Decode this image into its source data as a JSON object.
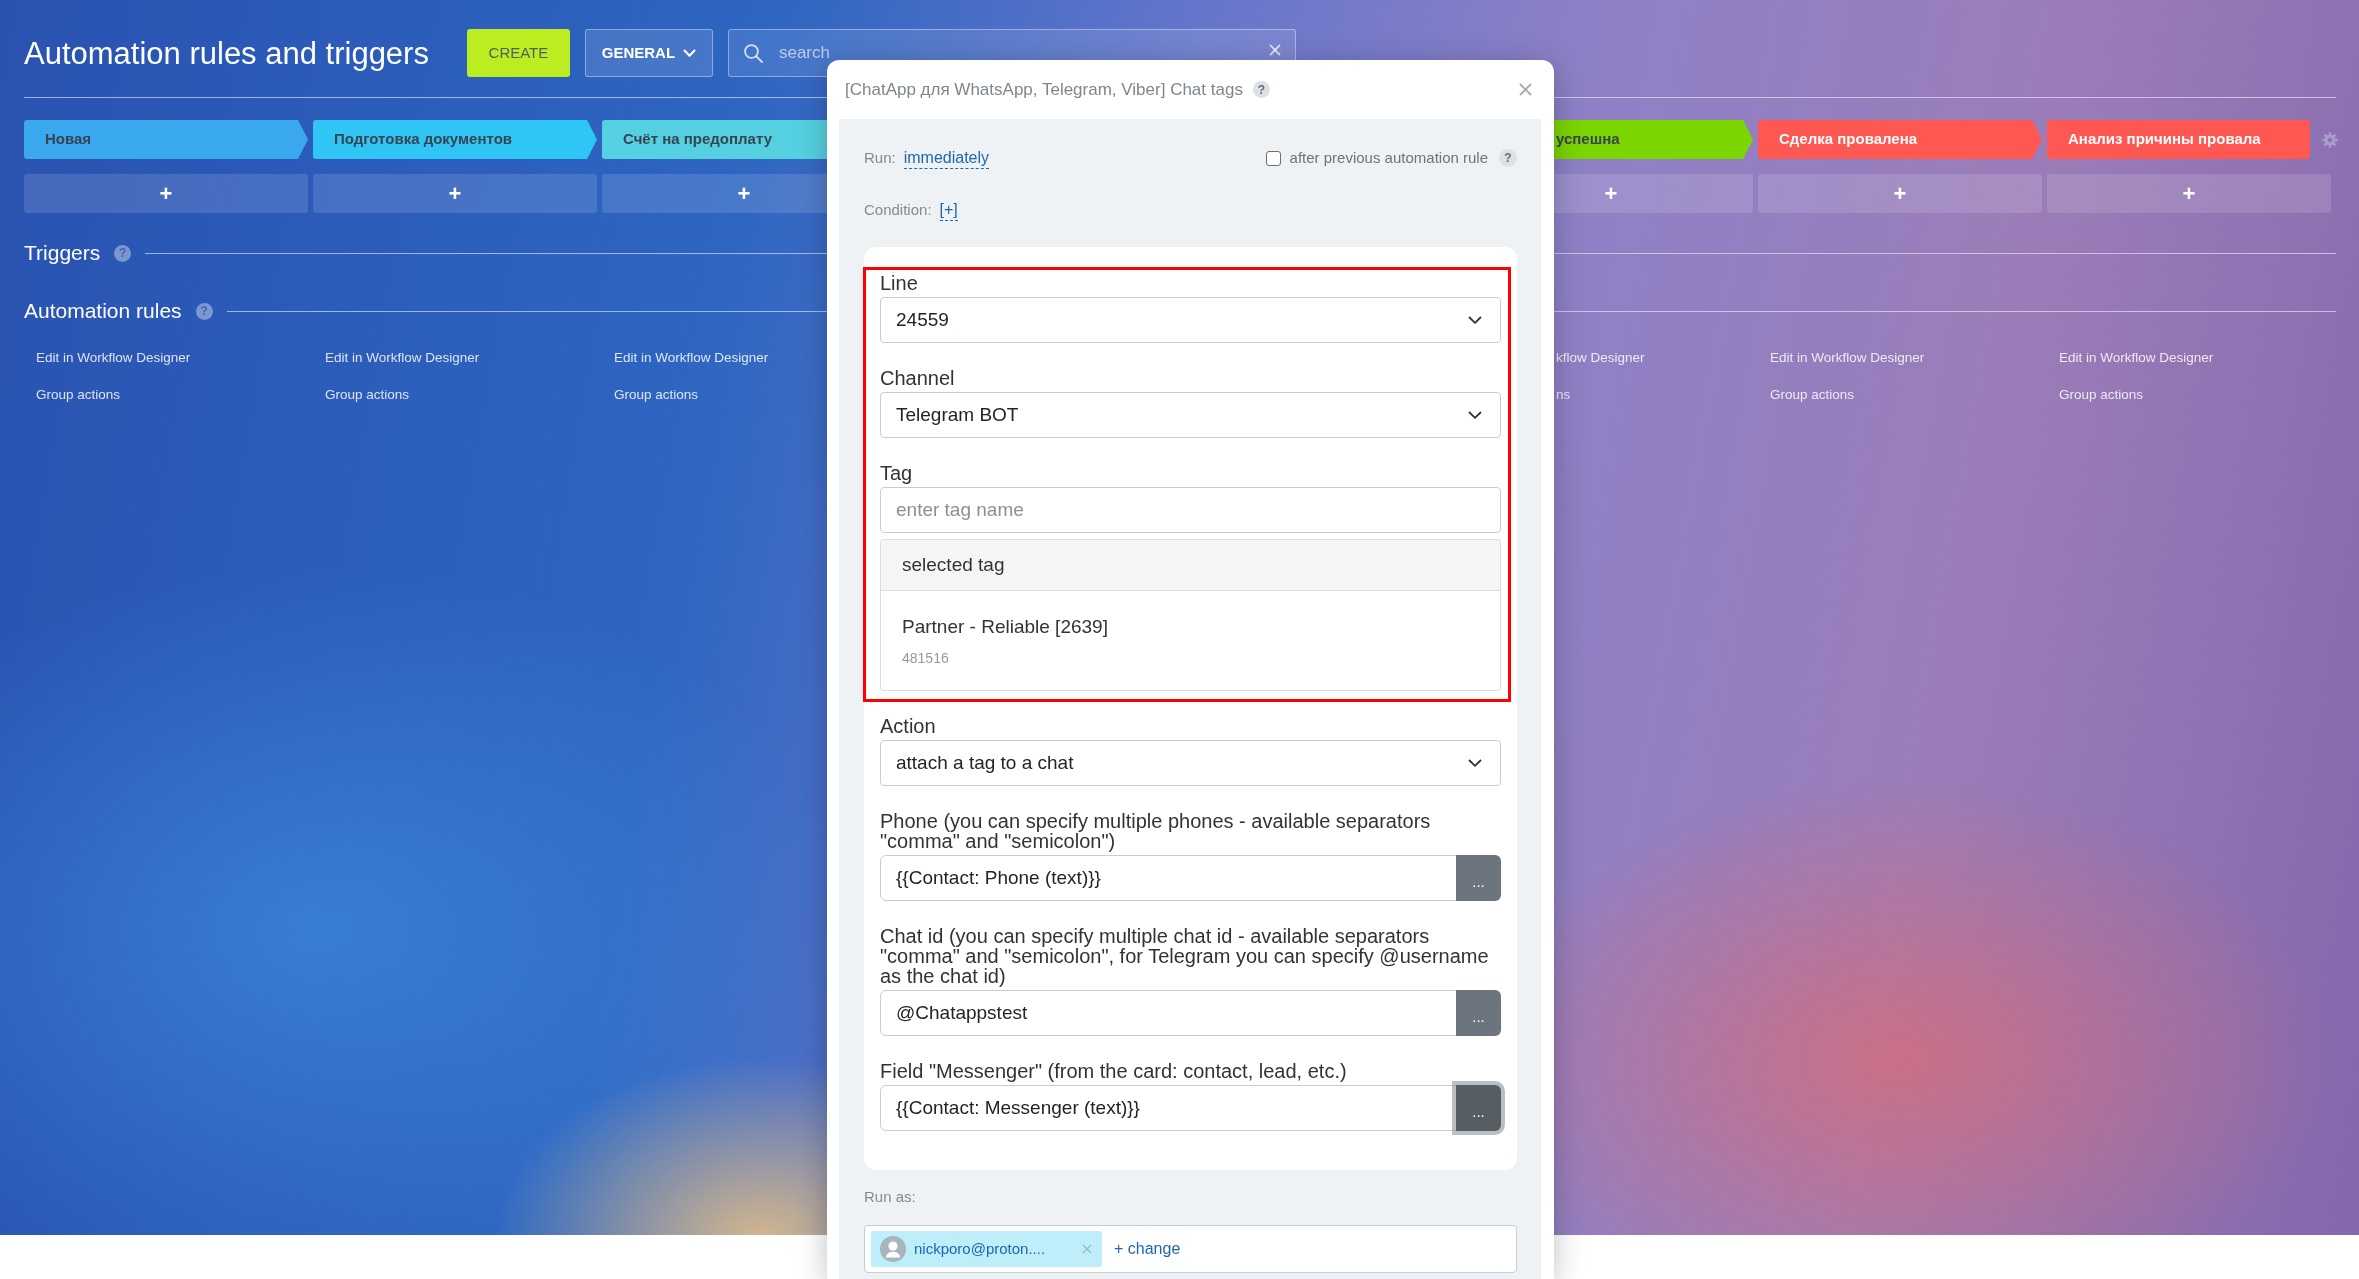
{
  "header": {
    "title": "Automation rules and triggers",
    "create_button": "CREATE",
    "general_button": "GENERAL",
    "search": {
      "placeholder": "search"
    }
  },
  "stages_left": [
    {
      "name": "Новая",
      "color": "#39a8ef",
      "add": "+",
      "links": [
        "Edit in Workflow Designer",
        "Group actions"
      ]
    },
    {
      "name": "Подготовка документов",
      "color": "#2fc6f6",
      "add": "+",
      "links": [
        "Edit in Workflow Designer",
        "Group actions"
      ]
    },
    {
      "name": "Счёт на предоплату",
      "color": "#55d0e0",
      "add": "+",
      "links": [
        "Edit in Workflow Designer",
        "Group actions"
      ]
    }
  ],
  "stages_right": [
    {
      "name": "успешна",
      "color": "#7bd500",
      "add": "+",
      "links": [
        "kflow Designer",
        "ns"
      ]
    },
    {
      "name": "Сделка провалена",
      "color": "#ff5752",
      "add": "+",
      "links": [
        "Edit in Workflow Designer",
        "Group actions"
      ]
    },
    {
      "name": "Анализ причины провала",
      "color": "#ff5752",
      "add": "+",
      "links": [
        "Edit in Workflow Designer",
        "Group actions"
      ]
    }
  ],
  "sections": [
    {
      "title": "Triggers",
      "help": "?"
    },
    {
      "title": "Automation rules",
      "help": "?"
    }
  ],
  "modal": {
    "title": {
      "text": "[ChatApp для WhatsApp, Telegram, Viber] Chat tags",
      "help": "?"
    },
    "run": {
      "label": "Run:",
      "value": "immediately"
    },
    "after_previous": {
      "label": "after previous automation rule",
      "checked": false,
      "help": "?"
    },
    "condition": {
      "label": "Condition:",
      "value": "[+]"
    },
    "highlighted_fields": [
      {
        "kind": "select",
        "label": "Line",
        "value": "24559"
      },
      {
        "kind": "select",
        "label": "Channel",
        "value": "Telegram BOT"
      },
      {
        "kind": "tag_picker",
        "label": "Tag",
        "placeholder": "enter tag name",
        "list_header": "selected tag",
        "options": [
          {
            "title": "Partner - Reliable [2639]",
            "subtitle": "481516"
          }
        ]
      }
    ],
    "fields": [
      {
        "kind": "select",
        "label": "Action",
        "value": "attach a tag to a chat"
      },
      {
        "kind": "text_picker",
        "label": "Phone (you can specify multiple phones - available separators \"comma\" and \"semicolon\")",
        "value": "{{Contact: Phone (text)}}",
        "button": {
          "label": "...",
          "focused": false
        }
      },
      {
        "kind": "text_picker",
        "label": "Chat id (you can specify multiple chat id - available separators \"comma\" and \"semicolon\", for Telegram you can specify @username as the chat id)",
        "value": "@Chatappstest",
        "button": {
          "label": "...",
          "focused": false
        }
      },
      {
        "kind": "text_picker",
        "label": "Field \"Messenger\" (from the card: contact, lead, etc.)",
        "value": "{{Contact: Messenger (text)}}",
        "button": {
          "label": "...",
          "focused": true
        }
      }
    ],
    "run_as": {
      "label": "Run as:",
      "user": "nickporo@proton....",
      "change": "+ change"
    }
  }
}
